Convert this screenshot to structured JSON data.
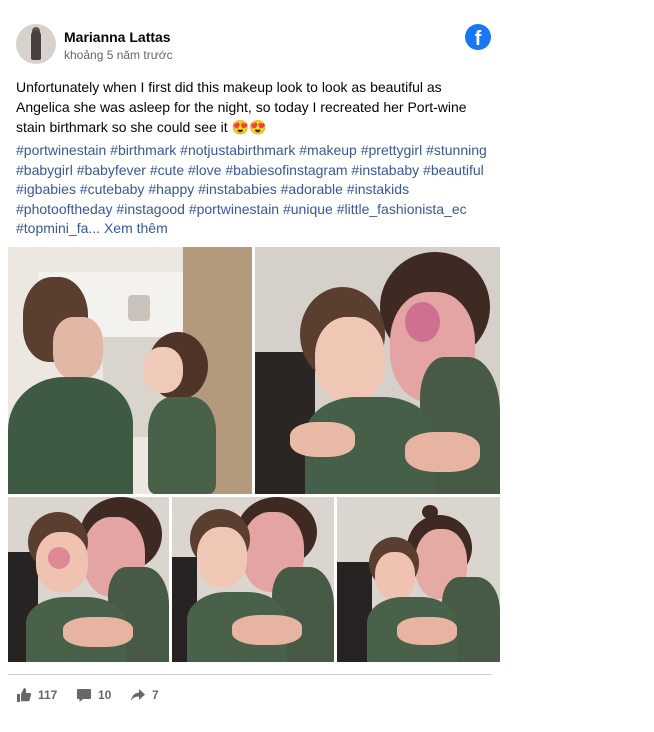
{
  "post": {
    "author": "Marianna Lattas",
    "timestamp": "khoảng 5 năm trước",
    "caption": "Unfortunately when I first did this makeup look to look as beautiful as Angelica she was asleep for the night, so today I recreated her Port-wine stain birthmark so she could see it 😍😍",
    "hashtags": "#portwinestain #birthmark #notjustabirthmark #makeup #prettygirl #stunning #babygirl #babyfever #cute #love #babiesofinstagram #instababy #beautiful #igbabies #cutebaby #happy #instababies #adorable #instakids #photooftheday #instagood #portwinestain #unique #little_fashionista_ec #topmini_fa...",
    "see_more": "Xem thêm",
    "platform_icon": "f"
  },
  "stats": {
    "likes": "117",
    "comments": "10",
    "shares": "7"
  },
  "icons": {
    "like": "thumbs-up-icon",
    "comment": "comment-icon",
    "share": "share-icon",
    "platform": "facebook-icon"
  },
  "colors": {
    "facebook_blue": "#1877f2",
    "hashtag": "#385898",
    "meta_text": "#65676b"
  }
}
